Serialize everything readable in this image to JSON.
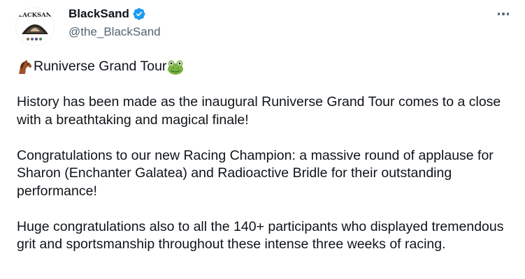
{
  "author": {
    "display_name": "BlackSand",
    "handle": "@the_BlackSand",
    "avatar_text": "BLACKSAND",
    "verified_icon": "verified-badge-icon",
    "verified_color": "#1d9bf0"
  },
  "menu_icon": "more-options-icon",
  "tweet": {
    "title": "Runiverse Grand Tour",
    "title_leading_icon": "horse-emoji",
    "title_trailing_icon": "frog-emoji",
    "paragraph_1": "History has been made as the inaugural Runiverse Grand Tour comes to a close with a breathtaking and magical finale!",
    "paragraph_2": "Congratulations to our new Racing Champion: a massive round of applause for Sharon (Enchanter Galatea) and Radioactive Bridle for their outstanding performance!",
    "paragraph_3": "Huge congratulations also to all the 140+ participants who displayed tremendous grit and sportsmanship throughout these intense three weeks of racing."
  }
}
